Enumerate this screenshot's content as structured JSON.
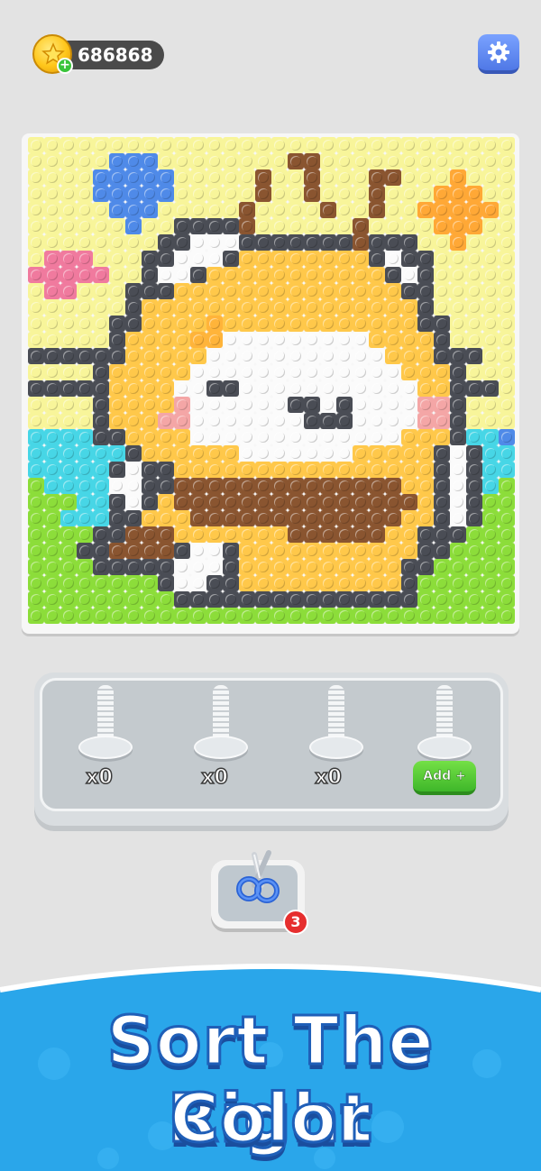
{
  "currency": {
    "coins": "686868",
    "icon": "star-coin-icon",
    "add_icon": "plus-icon"
  },
  "settings": {
    "icon": "gear-icon"
  },
  "board": {
    "columns": 30,
    "rows": 30,
    "palette": {
      "y": "#f8f59a",
      "b": "#4f8ae8",
      "p": "#f07a9e",
      "o": "#ffa836",
      "k": "#4a4d55",
      "n": "#8a5530",
      "w": "#fbfbfb",
      "Y": "#ffc84a",
      "O": "#ffb43a",
      "c": "#47d6e6",
      "g": "#8cdd3a",
      "G": "#64c83a",
      "B": "#3e7fe0",
      "P": "#f4a6a6",
      "s": "#e7e7e7"
    },
    "rows_data": [
      "yyyyyyyyyyyyyyyyyyyyyyyyyyyyyy",
      "yyyyybbbyyyyyyyynnyyyyyyyyyyyy",
      "yyyybbbbbyyyyynyynyyynnyyyoyyy",
      "yyyybbbbbyyyyynyynyyynyyyoooyy",
      "yyyyybbbyyyyynyyyynyynyyoooooy",
      "yyyyyybyykkkknyyyyyynyyyyoooyy",
      "yyyyyyyykkwwwkkkkkkknkkkyyoyyy",
      "ypppyyykkwwwkYYYYYYYYkwkkyyyyy",
      "pppppyykwwkYYYYYYYYYYYkwkyyyyy",
      "yppyyykkkYYYYYYYYYYYYYYkkyyyyy",
      "yyyyyykYYYYYYYYYYYYYYYYYkyyyyy",
      "yyyyykkYYYYOYYYYYYYYYYYYkkyyyy",
      "yyyyykYYYYOOwwwwwwwwwYYYYkyyyy",
      "kkkkkkYYYYYwwwwwwwwwwwYYYkkkyy",
      "yyyykYYYYYwwwwwwwwwwwwwYYYkyyy",
      "kkkkkYYYYwwkkwwwwwwwwwwwYYkkky",
      "yyyykYYYYPwwwwwwkkwkwwwwPPkyyy",
      "yyyykYYYPPwwwwwwwkkkwwwwPPkyyy",
      "cccckkYYYYwwwwwwwwwwwwwYYYkccb",
      "cccccckYYYYYYwwwwwwwYYYYYkwkcc",
      "ccccckwkkYYYYYYYYYYYYYYYYkwkcc",
      "gccccwwkknnnnnnnnnnnnnnYYkwkcg",
      "gggcckwkYnnnnnnnnnnnnnnnYkwkgg",
      "ggccckkYYYnnnnnnnnnnnnnYYkwkgg",
      "ggggkknnnYYYYYYYnnnnnnYYkkkggg",
      "gggkknnnnkwwkYYYYYYYYYYYkkgggg",
      "ggggkkkkkwwwkYYYYYYYYYYkkggggg",
      "ggggggggkwwkkYYYYYYYYYYkgggggg",
      "gggggggggkkkkkkkkkkkkkkkgggggg",
      "gggggggggggggggggggggggggggggg"
    ]
  },
  "tray": {
    "pegs": [
      {
        "count_label": "x0"
      },
      {
        "count_label": "x0"
      },
      {
        "count_label": "x0"
      },
      {
        "action_label": "Add +"
      }
    ]
  },
  "tool": {
    "icon": "scissors-icon",
    "badge": "3"
  },
  "banner": {
    "line1": "Sort The Right",
    "line2": "Color",
    "bg_color": "#2aa6ea"
  }
}
